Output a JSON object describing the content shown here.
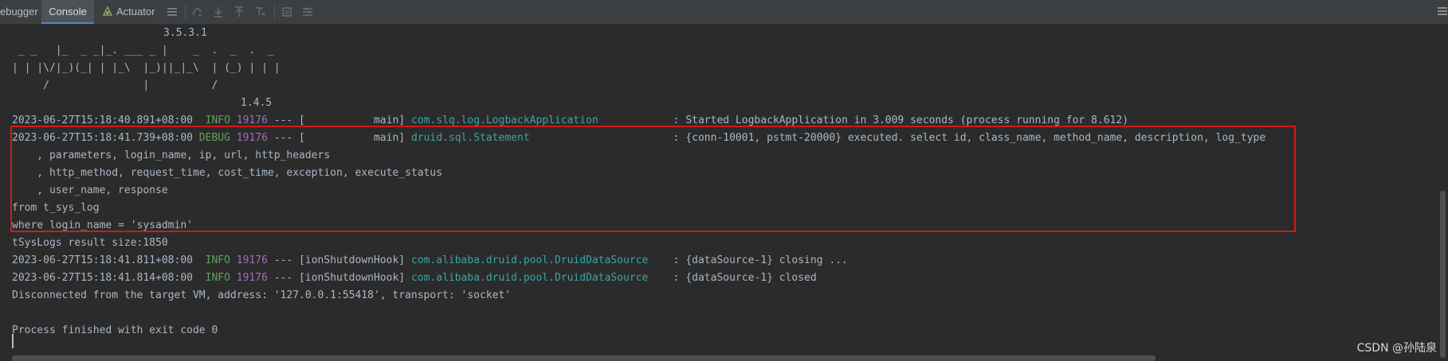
{
  "toolbar": {
    "tabs": {
      "debugger": "ebugger",
      "console": "Console",
      "actuator": "Actuator"
    },
    "icons": [
      "menu-icon",
      "restore-icon",
      "scroll-down-icon",
      "scroll-up-icon",
      "filter-icon",
      "print-icon",
      "settings-icon"
    ]
  },
  "console": {
    "banner": {
      "version": "3.5.3.1",
      "art1": " _ _   |_  _ _|_. ___ _ |    _  .  _  .  _",
      "art2": "| | |\\/|_)(_| | |_\\  |_)||_|_\\  | (_) | | |",
      "art3": "     /               |          /",
      "version2": "1.4.5"
    },
    "line_started": {
      "ts": "2023-06-27T15:18:40.891+08:00",
      "level": "  INFO",
      "pid": "19176",
      "sep": " --- [           main] ",
      "logger": "com.slq.log.LogbackApplication           ",
      "msg": " : Started LogbackApplication in 3.009 seconds (process running for 8.612)"
    },
    "line_sql": {
      "ts": "2023-06-27T15:18:41.739+08:00",
      "level": " DEBUG",
      "pid": "19176",
      "sep": " --- [           main] ",
      "logger": "druid.sql.Statement                      ",
      "msg": " : {conn-10001, pstmt-20000} executed. select id, class_name, method_name, description, log_type"
    },
    "sql_cont": [
      "    , parameters, login_name, ip, url, http_headers",
      "    , http_method, request_time, cost_time, exception, execute_status",
      "    , user_name, response",
      "from t_sys_log",
      "where login_name = 'sysadmin'"
    ],
    "result": "tSysLogs result size:1850",
    "line_closing": {
      "ts": "2023-06-27T15:18:41.811+08:00",
      "level": "  INFO",
      "pid": "19176",
      "sep": " --- [ionShutdownHook] ",
      "logger": "com.alibaba.druid.pool.DruidDataSource   ",
      "msg": " : {dataSource-1} closing ..."
    },
    "line_closed": {
      "ts": "2023-06-27T15:18:41.814+08:00",
      "level": "  INFO",
      "pid": "19176",
      "sep": " --- [ionShutdownHook] ",
      "logger": "com.alibaba.druid.pool.DruidDataSource   ",
      "msg": " : {dataSource-1} closed"
    },
    "disconnected": "Disconnected from the target VM, address: '127.0.0.1:55418', transport: 'socket'",
    "finished": "Process finished with exit code 0"
  },
  "watermark": "CSDN @孙陆泉",
  "colors": {
    "background": "#2b2b2b",
    "toolbar": "#3c3f41",
    "text": "#a9b7c6",
    "info": "#5fa05f",
    "pid": "#a16eb7",
    "logger": "#3aa5a5",
    "highlight_border": "#d11a1a"
  }
}
